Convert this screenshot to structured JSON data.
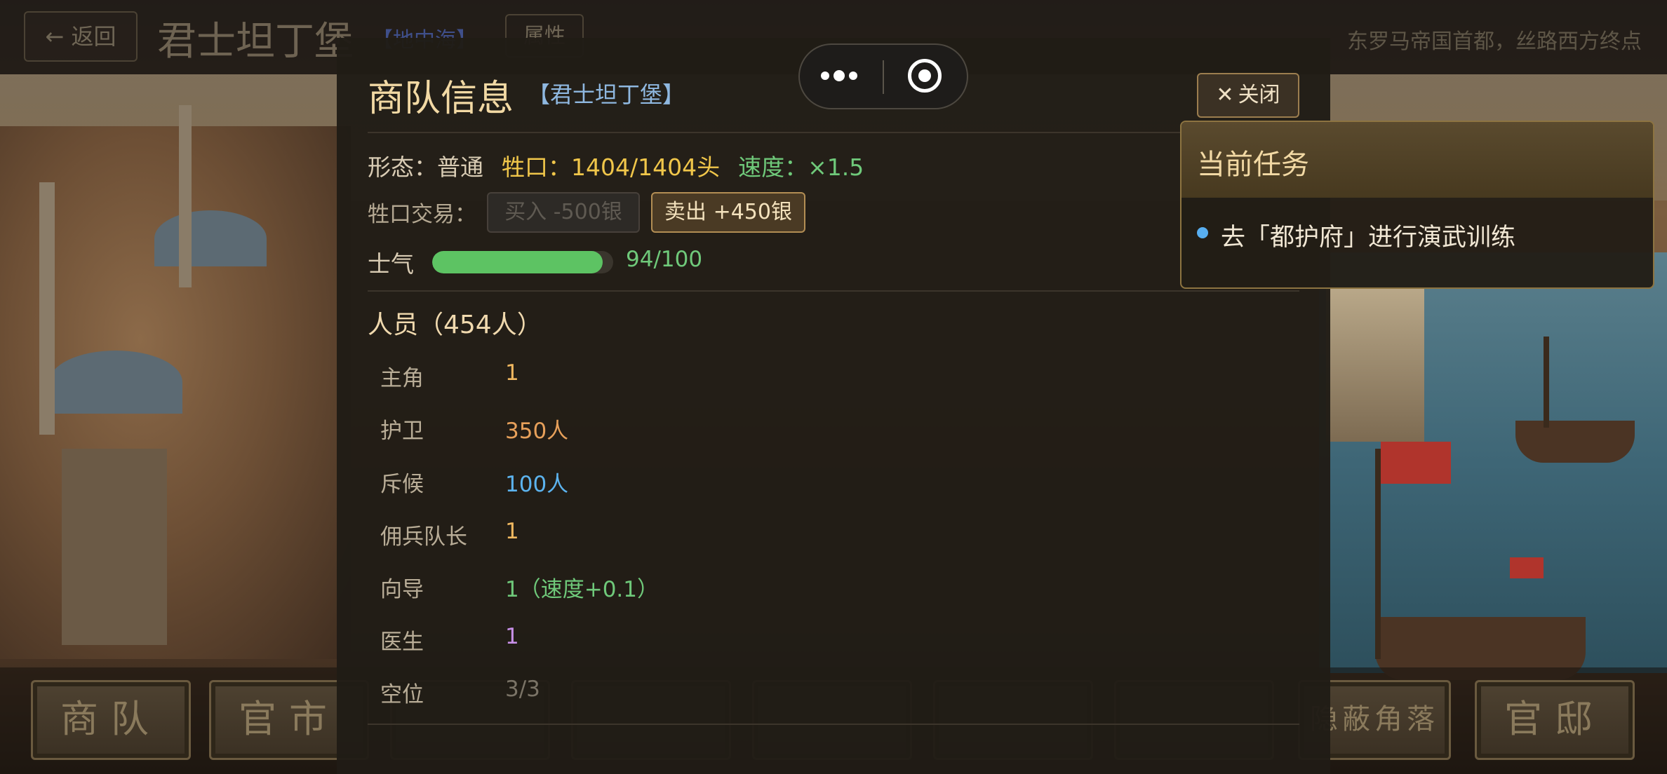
{
  "topbar": {
    "back_label": "← 返回",
    "city_title": "君士坦丁堡",
    "region_tag": "【地中海】",
    "attr_label": "属性",
    "city_desc": "东罗马帝国首都，丝路西方终点"
  },
  "bottom_nav": {
    "items": [
      "商队",
      "官市",
      "",
      "",
      "",
      "",
      "",
      "隐蔽角落",
      "官邸"
    ]
  },
  "modal": {
    "title": "商队信息",
    "subtitle": "【君士坦丁堡】",
    "close_label": "关闭",
    "form_label": "形态：",
    "form_value": "普通",
    "livestock_label": "牲口：1404/1404头",
    "speed_label": "速度：×1.5",
    "trade_label": "牲口交易：",
    "buy_label": "买入 -500银",
    "sell_label": "卖出 +450银",
    "morale_label": "士气",
    "morale_value": "94/100",
    "morale_fraction": 0.94,
    "personnel_title": "人员（454人）",
    "personnel": [
      {
        "key": "主角",
        "value": "1",
        "color": "#f0b860"
      },
      {
        "key": "护卫",
        "value": "350人",
        "color": "#e7a05a"
      },
      {
        "key": "斥候",
        "value": "100人",
        "color": "#5cb3ee"
      },
      {
        "key": "佣兵队长",
        "value": "1",
        "color": "#f0b860"
      },
      {
        "key": "向导",
        "value": "1（速度+0.1）",
        "color": "#6fc97a"
      },
      {
        "key": "医生",
        "value": "1",
        "color": "#c890e8"
      },
      {
        "key": "空位",
        "value": "3/3",
        "color": "#7a7366"
      }
    ]
  },
  "task_panel": {
    "title": "当前任务",
    "item": "去「都护府」进行演武训练"
  },
  "colors": {
    "accent_gold": "#f2d9a4",
    "green": "#6fc97a",
    "blue": "#58aef0",
    "yellow": "#f0c64a"
  },
  "icons": [
    "close-icon",
    "more-dots-icon",
    "record-target-icon",
    "bullet-dot-icon"
  ]
}
